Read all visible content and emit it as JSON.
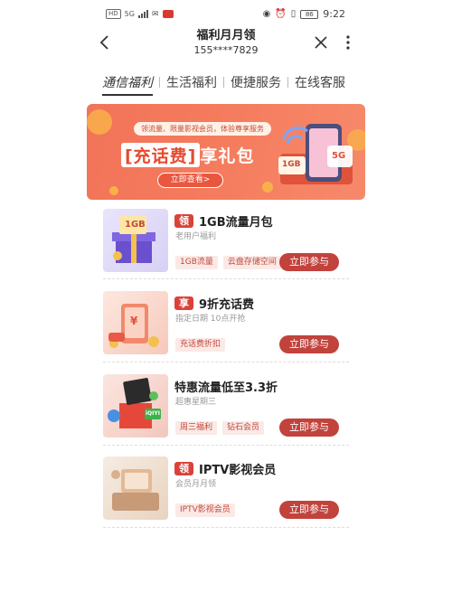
{
  "status_bar": {
    "left_badge": "HD",
    "network": "5G",
    "time": "9:22",
    "battery": "86"
  },
  "header": {
    "title": "福利月月领",
    "subtitle": "155****7829",
    "back_icon": "chevron-left-icon",
    "close_icon": "close-icon",
    "more_icon": "more-vertical-icon"
  },
  "tabs": [
    {
      "label": "通信福利",
      "active": true
    },
    {
      "label": "生活福利",
      "active": false
    },
    {
      "label": "便捷服务",
      "active": false
    },
    {
      "label": "在线客服",
      "active": false
    }
  ],
  "banner": {
    "pill": "领流量、限量影视会员，体验尊享服务",
    "title_bracket": "[充话费]",
    "title_rest": "享礼包",
    "button": "立即查看>",
    "art_1gb": "1GB",
    "art_5g": "5G"
  },
  "cards": [
    {
      "badge": "领",
      "title": "1GB流量月包",
      "desc": "老用户福利",
      "tags": [
        "1GB流量",
        "云盘存储空间"
      ],
      "button": "立即参与",
      "art": "1GB"
    },
    {
      "badge": "享",
      "title": "9折充话费",
      "desc": "指定日期  10点开抢",
      "tags": [
        "充话费折扣"
      ],
      "button": "立即参与",
      "art": "¥"
    },
    {
      "badge": "",
      "title": "特惠流量低至3.3折",
      "desc": "超惠星期三",
      "tags": [
        "周三福利",
        "钻石会员"
      ],
      "button": "立即参与",
      "art": "iQIYI"
    },
    {
      "badge": "领",
      "title": "IPTV影视会员",
      "desc": "会员月月领",
      "tags": [
        "IPTV影视会员"
      ],
      "button": "立即参与",
      "art": ""
    }
  ],
  "colors": {
    "accent": "#c2423c",
    "badge": "#d9423a",
    "banner": "#f2745a",
    "tag_bg": "#fbe9e6"
  }
}
